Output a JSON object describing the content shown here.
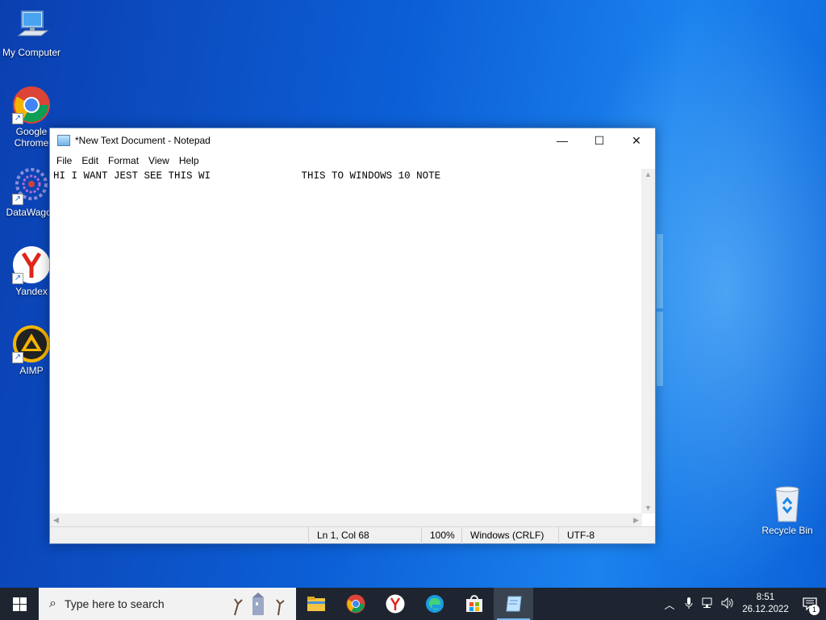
{
  "desktop": {
    "icons": [
      {
        "label": "My Computer"
      },
      {
        "label": "Google Chrome"
      },
      {
        "label": "DataWagon"
      },
      {
        "label": "Yandex"
      },
      {
        "label": "AIMP"
      }
    ],
    "recycle_bin": {
      "label": "Recycle Bin"
    }
  },
  "notepad": {
    "title": "*New Text Document - Notepad",
    "menu": [
      "File",
      "Edit",
      "Format",
      "View",
      "Help"
    ],
    "content": "HI I WANT JEST SEE THIS WI               THIS TO WINDOWS 10 NOTE",
    "status": {
      "position": "Ln 1, Col 68",
      "zoom": "100%",
      "line_ending": "Windows (CRLF)",
      "encoding": "UTF-8"
    },
    "controls": {
      "minimize": "—",
      "maximize": "☐",
      "close": "✕"
    }
  },
  "taskbar": {
    "search_placeholder": "Type here to search",
    "apps": [
      "file-explorer",
      "chrome",
      "yandex",
      "edge",
      "microsoft-store",
      "notepad"
    ],
    "clock": {
      "time": "8:51",
      "date": "26.12.2022"
    },
    "notification_count": "1"
  },
  "colors": {
    "taskbar_bg": "#1e2530",
    "desktop_blue": "#0c5fd6",
    "window_border": "#6a8fc8"
  }
}
